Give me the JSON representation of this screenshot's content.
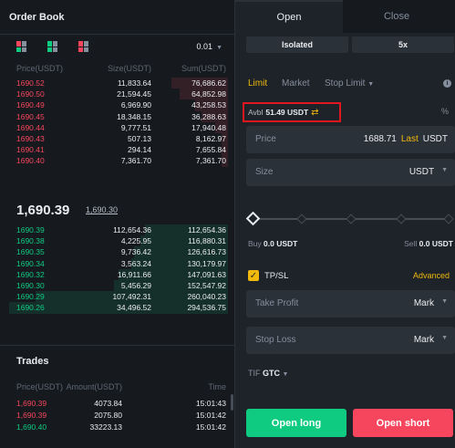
{
  "order_book": {
    "title": "Order Book",
    "precision": "0.01",
    "columns": {
      "price": "Price(USDT)",
      "size": "Size(USDT)",
      "sum": "Sum(USDT)"
    },
    "asks": [
      {
        "price": "1690.52",
        "size": "11,833.64",
        "sum": "76,686.62",
        "depth": 0.26
      },
      {
        "price": "1690.50",
        "size": "21,594.45",
        "sum": "64,852.98",
        "depth": 0.22
      },
      {
        "price": "1690.49",
        "size": "6,969.90",
        "sum": "43,258.53",
        "depth": 0.15
      },
      {
        "price": "1690.45",
        "size": "18,348.15",
        "sum": "36,288.63",
        "depth": 0.12
      },
      {
        "price": "1690.44",
        "size": "9,777.51",
        "sum": "17,940.48",
        "depth": 0.06
      },
      {
        "price": "1690.43",
        "size": "507.13",
        "sum": "8,162.97",
        "depth": 0.03
      },
      {
        "price": "1690.41",
        "size": "294.14",
        "sum": "7,655.84",
        "depth": 0.03
      },
      {
        "price": "1690.40",
        "size": "7,361.70",
        "sum": "7,361.70",
        "depth": 0.03
      }
    ],
    "mid": {
      "price": "1,690.39",
      "mark": "1,690.30"
    },
    "bids": [
      {
        "price": "1690.39",
        "size": "112,654.36",
        "sum": "112,654.36",
        "depth": 0.38
      },
      {
        "price": "1690.38",
        "size": "4,225.95",
        "sum": "116,880.31",
        "depth": 0.4
      },
      {
        "price": "1690.35",
        "size": "9,736.42",
        "sum": "126,616.73",
        "depth": 0.43
      },
      {
        "price": "1690.34",
        "size": "3,563.24",
        "sum": "130,179.97",
        "depth": 0.44
      },
      {
        "price": "1690.32",
        "size": "16,911.66",
        "sum": "147,091.63",
        "depth": 0.5
      },
      {
        "price": "1690.30",
        "size": "5,456.29",
        "sum": "152,547.92",
        "depth": 0.52
      },
      {
        "price": "1690.29",
        "size": "107,492.31",
        "sum": "260,040.23",
        "depth": 0.88
      },
      {
        "price": "1690.26",
        "size": "34,496.52",
        "sum": "294,536.75",
        "depth": 1.0
      }
    ]
  },
  "trades": {
    "title": "Trades",
    "columns": {
      "price": "Price(USDT)",
      "amount": "Amount(USDT)",
      "time": "Time"
    },
    "rows": [
      {
        "price": "1,690.39",
        "amount": "4073.84",
        "time": "15:01:43",
        "side": "sell"
      },
      {
        "price": "1,690.39",
        "amount": "2075.80",
        "time": "15:01:42",
        "side": "sell"
      },
      {
        "price": "1,690.40",
        "amount": "33223.13",
        "time": "15:01:42",
        "side": "buy"
      }
    ]
  },
  "order_panel": {
    "tabs": {
      "open": "Open",
      "close": "Close"
    },
    "margin_mode": "Isolated",
    "leverage": "5x",
    "order_types": {
      "limit": "Limit",
      "market": "Market",
      "stop_limit": "Stop Limit"
    },
    "avbl": {
      "label": "Avbl",
      "value": "51.49 USDT"
    },
    "price_field": {
      "label": "Price",
      "value": "1688.71",
      "last": "Last",
      "unit": "USDT"
    },
    "size_field": {
      "label": "Size",
      "unit": "USDT"
    },
    "slider_percent": 0,
    "buy_label": "Buy",
    "buy_value": "0.0 USDT",
    "sell_label": "Sell",
    "sell_value": "0.0 USDT",
    "tpsl": {
      "label": "TP/SL",
      "advanced": "Advanced",
      "checked": true
    },
    "take_profit": {
      "label": "Take Profit",
      "mode": "Mark"
    },
    "stop_loss": {
      "label": "Stop Loss",
      "mode": "Mark"
    },
    "tif": {
      "label": "TIF",
      "value": "GTC"
    },
    "buttons": {
      "long": "Open long",
      "short": "Open short"
    },
    "colors": {
      "accent": "#f0b90b",
      "buy": "#0ecb81",
      "sell": "#f6465d",
      "highlight_border": "#e0171f"
    }
  }
}
